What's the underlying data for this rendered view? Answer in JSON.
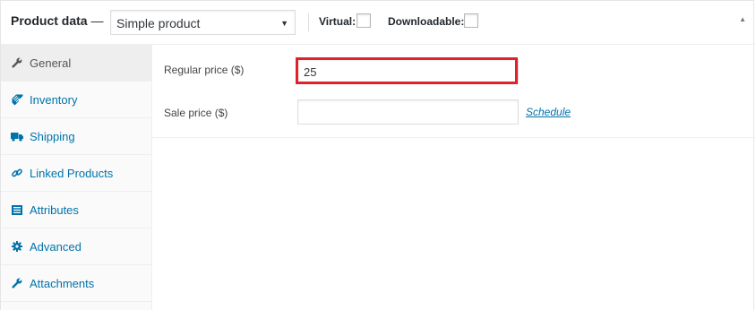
{
  "header": {
    "title": "Product data",
    "dash": "—",
    "product_type": {
      "selected": "Simple product",
      "caret": "▼"
    },
    "virtual_label": "Virtual:",
    "downloadable_label": "Downloadable:",
    "virtual_checked": false,
    "downloadable_checked": false,
    "collapse_icon": "▲"
  },
  "tabs": [
    {
      "label": "General",
      "icon": "wrench-icon",
      "active": true
    },
    {
      "label": "Inventory",
      "icon": "tag-icon",
      "active": false
    },
    {
      "label": "Shipping",
      "icon": "truck-icon",
      "active": false
    },
    {
      "label": "Linked Products",
      "icon": "link-icon",
      "active": false
    },
    {
      "label": "Attributes",
      "icon": "list-icon",
      "active": false
    },
    {
      "label": "Advanced",
      "icon": "gear-icon",
      "active": false
    },
    {
      "label": "Attachments",
      "icon": "wrench-icon",
      "active": false
    }
  ],
  "general": {
    "regular_price_label": "Regular price ($)",
    "regular_price_value": "25",
    "sale_price_label": "Sale price ($)",
    "sale_price_value": "",
    "schedule_label": "Schedule"
  },
  "colors": {
    "link": "#0073aa",
    "highlight": "#e0202b",
    "tab_bg": "#fafafa",
    "tab_active_bg": "#eeeeee"
  }
}
